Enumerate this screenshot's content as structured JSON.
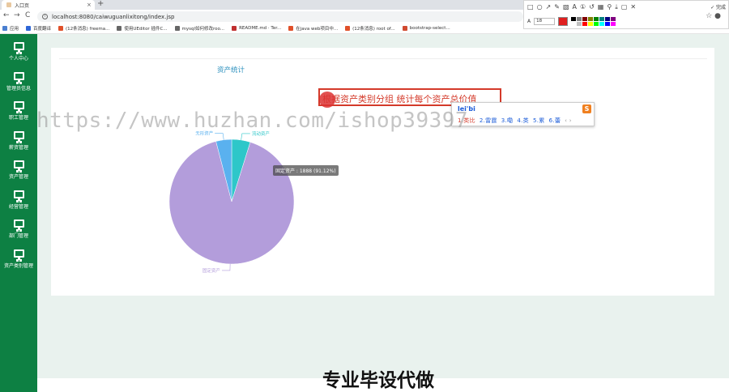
{
  "browser": {
    "tab_title": "入口页",
    "tab_close": "×",
    "new_tab": "+",
    "url": "localhost:8080/caiwuguanlixitong/index.jsp",
    "back": "←",
    "forward": "→",
    "reload": "C",
    "bookmarks": [
      {
        "label": "应用",
        "color": "#4a7fd0"
      },
      {
        "label": "百度翻译",
        "color": "#2f66d6"
      },
      {
        "label": "(12条消息) freema...",
        "color": "#e0502a"
      },
      {
        "label": "使用UEditor 插件C...",
        "color": "#666666"
      },
      {
        "label": "mysql如何修改roo...",
        "color": "#666666"
      },
      {
        "label": "README.md · Ter...",
        "color": "#c03030"
      },
      {
        "label": "在java web项目中...",
        "color": "#e0502a"
      },
      {
        "label": "(12条消息) root of...",
        "color": "#e0502a"
      },
      {
        "label": "bootstrap-select...",
        "color": "#d04a30"
      }
    ]
  },
  "snap_toolbar": {
    "font_size": "18",
    "finish_label": "✓ 完成",
    "current_color": "#e02020",
    "palette": [
      "#000000",
      "#808080",
      "#800000",
      "#808000",
      "#008000",
      "#008080",
      "#000080",
      "#800080",
      "#ffffff",
      "#c0c0c0",
      "#ff0000",
      "#ffff00",
      "#00ff00",
      "#00ffff",
      "#0000ff",
      "#ff00ff"
    ]
  },
  "sidebar": {
    "items": [
      {
        "label": "个人中心"
      },
      {
        "label": "管理员信息"
      },
      {
        "label": "职工管理"
      },
      {
        "label": "薪资管理"
      },
      {
        "label": "资产管理"
      },
      {
        "label": "经营管理"
      },
      {
        "label": "部门管理"
      },
      {
        "label": "资产类别管理"
      }
    ]
  },
  "main": {
    "panel_title": "资产统计",
    "annotation": "根据资产类别分组 统计每个资产总价值",
    "ime": {
      "input": "lei'bi",
      "candidates": [
        "1.类比",
        "2.雷霆",
        "3.嘞",
        "4.类",
        "5.累",
        "6.蕾"
      ],
      "nav": "‹ ›",
      "logo": "S"
    },
    "watermark": "https://www.huzhan.com/ishop39397",
    "tooltip": "固定资产 : 1888 (91.12%)"
  },
  "chart_data": {
    "type": "pie",
    "slices": [
      {
        "name": "固定资产",
        "value": 1888,
        "percent": 91.12,
        "color": "#b39ddb"
      },
      {
        "name": "无形资产",
        "value": 84,
        "color": "#5ab1ef"
      },
      {
        "name": "流动资产",
        "value": 100,
        "color": "#2ec7c9"
      }
    ]
  },
  "footer": {
    "caption": "专业毕设代做"
  }
}
